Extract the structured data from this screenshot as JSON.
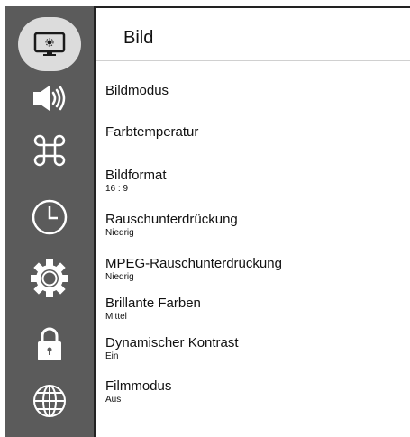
{
  "header": {
    "title": "Bild"
  },
  "sidebar": {
    "items": [
      {
        "icon": "picture-icon"
      },
      {
        "icon": "speaker-icon"
      },
      {
        "icon": "command-icon"
      },
      {
        "icon": "clock-icon"
      },
      {
        "icon": "settings-gear-icon"
      },
      {
        "icon": "lock-icon"
      },
      {
        "icon": "globe-icon"
      }
    ],
    "active_index": 0
  },
  "menu": {
    "items": [
      {
        "label": "Bildmodus",
        "value": ""
      },
      {
        "label": "Farbtemperatur",
        "value": ""
      },
      {
        "label": "Bildformat",
        "value": "16 : 9"
      },
      {
        "label": "Rauschunterdrückung",
        "value": "Niedrig"
      },
      {
        "label": "MPEG-Rauschunterdrückung",
        "value": "Niedrig"
      },
      {
        "label": "Brillante Farben",
        "value": "Mittel"
      },
      {
        "label": "Dynamischer Kontrast",
        "value": "Ein"
      },
      {
        "label": "Filmmodus",
        "value": "Aus"
      }
    ]
  },
  "colors": {
    "sidebar": "#5b5b5b",
    "active": "#dcdcdc",
    "icon": "#ffffff",
    "text": "#111111"
  }
}
